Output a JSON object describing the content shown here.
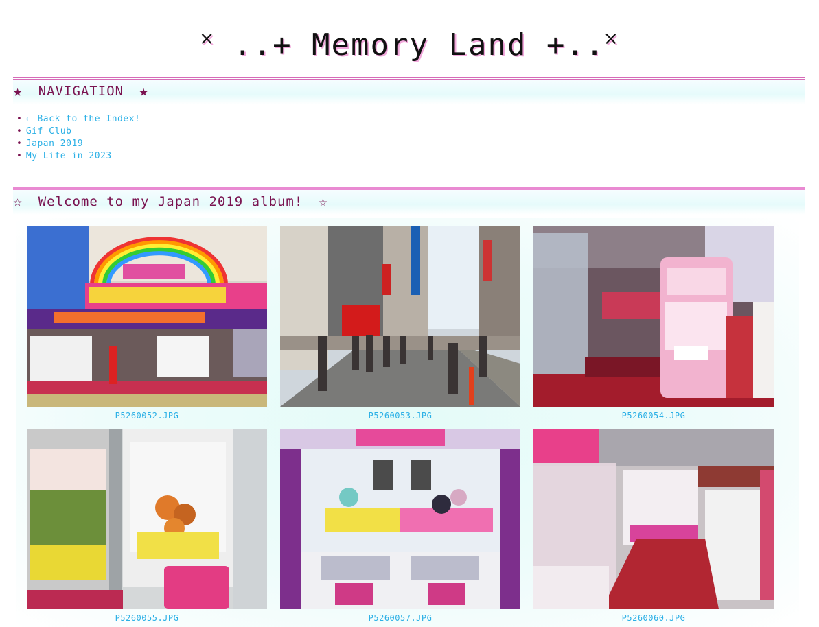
{
  "site": {
    "title": "˟ ..+ Memory Land +..˟"
  },
  "navigation": {
    "heading": "NAVIGATION",
    "star_left": "★",
    "star_right": "★",
    "links": [
      {
        "label": "← Back to the Index!"
      },
      {
        "label": "Gif Club"
      },
      {
        "label": "Japan 2019"
      },
      {
        "label": "My Life in 2023"
      }
    ]
  },
  "album": {
    "heading": "Welcome to my Japan 2019 album!",
    "star_left": "☆",
    "star_right": "☆",
    "photos": [
      {
        "caption": "P5260052.JPG",
        "subject": "arcade storefront with rainbow sign"
      },
      {
        "caption": "P5260053.JPG",
        "subject": "busy Akihabara street"
      },
      {
        "caption": "P5260054.JPG",
        "subject": "pink crane game machine"
      },
      {
        "caption": "P5260055.JPG",
        "subject": "claw machine with plush toys"
      },
      {
        "caption": "P5260057.JPG",
        "subject": "UFO catcher machine"
      },
      {
        "caption": "P5260060.JPG",
        "subject": "arcade interior with prize machines"
      }
    ]
  },
  "colors": {
    "heading": "#7a1350",
    "link": "#2bb0e6",
    "border": "#e98ad2",
    "title_shadow": "#f2a8dc"
  }
}
